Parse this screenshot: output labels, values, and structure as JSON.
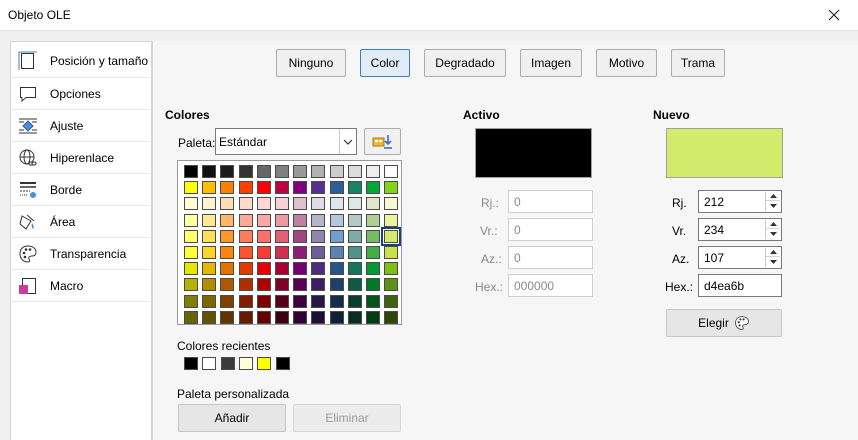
{
  "window": {
    "title": "Objeto OLE"
  },
  "sidebar": {
    "items": [
      {
        "label": "Posición y tamaño",
        "icon": "position-size-icon"
      },
      {
        "label": "Opciones",
        "icon": "speech-bubble-icon"
      },
      {
        "label": "Ajuste",
        "icon": "wrap-icon"
      },
      {
        "label": "Hiperenlace",
        "icon": "globe-link-icon"
      },
      {
        "label": "Borde",
        "icon": "border-icon"
      },
      {
        "label": "Área",
        "icon": "area-fill-icon",
        "selected": true
      },
      {
        "label": "Transparencia",
        "icon": "palette-icon"
      },
      {
        "label": "Macro",
        "icon": "macro-icon"
      }
    ]
  },
  "tabs": [
    {
      "label": "Ninguno"
    },
    {
      "label": "Color",
      "selected": true
    },
    {
      "label": "Degradado"
    },
    {
      "label": "Imagen"
    },
    {
      "label": "Motivo"
    },
    {
      "label": "Trama"
    }
  ],
  "colores": {
    "heading": "Colores",
    "palette_label": "Paleta:",
    "palette_value": "Estándar",
    "add_palette_icon": "add-palette-icon",
    "swatches": [
      [
        "#000000",
        "#111111",
        "#1c1c1c",
        "#333333",
        "#666666",
        "#808080",
        "#999999",
        "#b2b2b2",
        "#cccccc",
        "#dddddd",
        "#eeeeee",
        "#ffffff"
      ],
      [
        "#ffff00",
        "#ffbf00",
        "#ff8000",
        "#ff4000",
        "#ff0000",
        "#bf0041",
        "#800080",
        "#55308d",
        "#2a6099",
        "#158466",
        "#00a933",
        "#81d41a"
      ],
      [
        "#ffffd7",
        "#fff5ce",
        "#ffdbb6",
        "#ffd8ce",
        "#ffd7d7",
        "#f7d1d5",
        "#e0c2cd",
        "#dedce6",
        "#dee6ef",
        "#dee7e5",
        "#dde8cb",
        "#f6f9d4"
      ],
      [
        "#ffffa6",
        "#ffe994",
        "#ffb66c",
        "#ffaa95",
        "#ffa6a6",
        "#ec9ba4",
        "#bf819e",
        "#b7b3ca",
        "#b4c7dc",
        "#b3cac7",
        "#afd095",
        "#e8f2a1"
      ],
      [
        "#ffff6d",
        "#ffde59",
        "#ff972f",
        "#ff7b59",
        "#ff6d6d",
        "#e16173",
        "#a1467e",
        "#8e86ae",
        "#729fcf",
        "#81aca6",
        "#77bc65",
        "#d4ea6b"
      ],
      [
        "#ffff38",
        "#ffd428",
        "#ff860d",
        "#ff5429",
        "#ff3838",
        "#d62e4e",
        "#8d1d75",
        "#6b5e9b",
        "#5983b0",
        "#50938a",
        "#3faf46",
        "#c9e24b"
      ],
      [
        "#e6e600",
        "#e6b800",
        "#e67300",
        "#e63900",
        "#e60000",
        "#ab0034",
        "#730073",
        "#4c2b80",
        "#25568a",
        "#137559",
        "#009c2e",
        "#7bbf17"
      ],
      [
        "#b2b200",
        "#b28f00",
        "#b25900",
        "#b22d00",
        "#b20000",
        "#800027",
        "#590059",
        "#3b2163",
        "#1e416a",
        "#0e5a45",
        "#007a24",
        "#5e9212"
      ],
      [
        "#808000",
        "#806600",
        "#804000",
        "#802000",
        "#800000",
        "#560019",
        "#400040",
        "#281648",
        "#142e4c",
        "#0a3e30",
        "#00561a",
        "#42620c"
      ],
      [
        "#666600",
        "#665200",
        "#663300",
        "#661a00",
        "#660000",
        "#3d0011",
        "#330033",
        "#1e1035",
        "#0f2338",
        "#082e24",
        "#003d12",
        "#2f4608"
      ]
    ],
    "selected_swatch": "#d4ea6b",
    "recent_label": "Colores recientes",
    "recent": [
      "#000000",
      "#ffffff",
      "#3a3a3a",
      "#ffffd7",
      "#ffff00",
      "#000000"
    ],
    "custom_label": "Paleta personalizada",
    "add_button": "Añadir",
    "delete_button": "Eliminar"
  },
  "activo": {
    "heading": "Activo",
    "color": "#000000",
    "fields": [
      {
        "label": "Rj.:",
        "value": "0"
      },
      {
        "label": "Vr.:",
        "value": "0"
      },
      {
        "label": "Az.:",
        "value": "0"
      },
      {
        "label": "Hex.:",
        "value": "000000"
      }
    ]
  },
  "nuevo": {
    "heading": "Nuevo",
    "color": "#d4ea6b",
    "fields": [
      {
        "label": "Rj.",
        "value": "212"
      },
      {
        "label": "Vr.",
        "value": "234"
      },
      {
        "label": "Az.",
        "value": "107"
      },
      {
        "label": "Hex.:",
        "value": "d4ea6b"
      }
    ],
    "pick_button": "Elegir",
    "pick_icon": "color-picker-palette-icon"
  }
}
